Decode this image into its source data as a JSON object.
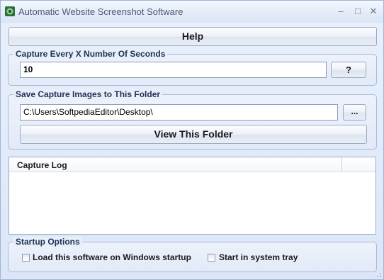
{
  "window": {
    "title": "Automatic Website Screenshot Software",
    "minimize": "–",
    "maximize": "□",
    "close": "✕"
  },
  "help_button": "Help",
  "capture_group": {
    "title": "Capture Every X Number Of Seconds",
    "seconds_value": "10",
    "help_button": "?"
  },
  "folder_group": {
    "title": "Save Capture Images to This Folder",
    "folder_value": "C:\\Users\\SoftpediaEditor\\Desktop\\",
    "browse_button": "...",
    "view_button": "View This Folder"
  },
  "capture_log": {
    "header": "Capture Log",
    "rows": []
  },
  "startup_group": {
    "title": "Startup Options",
    "options": [
      {
        "label": "Load this software on Windows startup",
        "checked": false
      },
      {
        "label": "Start in system tray",
        "checked": false
      }
    ]
  }
}
